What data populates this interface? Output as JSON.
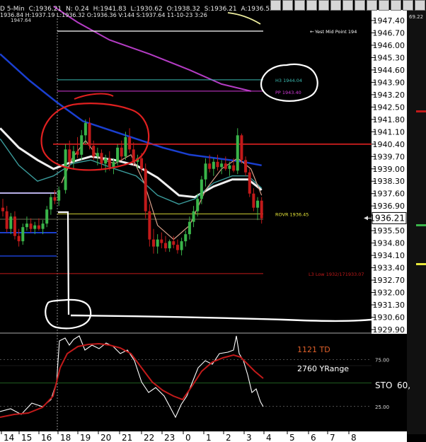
{
  "header": {
    "fields": [
      "D 5-Min",
      "C:1936.21",
      "N: 0.24",
      "H:1941.83",
      "L:1930.62",
      "O:1938.32",
      "S:1936.21",
      "A:1936.52"
    ],
    "fields2": [
      "1936.84",
      "H:1937.19",
      "L:1936.32",
      "O:1936.36",
      "V:144",
      "S:1937.64",
      "11-10-23",
      "3:26"
    ],
    "top_level_label": "1947.64",
    "right_edge_value": "69.22"
  },
  "chart_data": {
    "type": "line",
    "instrument_timeframe": "5-Min",
    "price_axis": {
      "ticks": [
        "1947.40",
        "1946.70",
        "1946.00",
        "1945.30",
        "1944.60",
        "1943.90",
        "1943.20",
        "1942.50",
        "1941.80",
        "1941.10",
        "1940.40",
        "1939.70",
        "1939.00",
        "1938.30",
        "1937.60",
        "1936.90",
        "1936.21",
        "1935.50",
        "1934.80",
        "1934.10",
        "1933.40",
        "1932.70",
        "1932.00",
        "1931.30",
        "1930.60",
        "1929.90"
      ],
      "current_price": "1936.21",
      "ylim": [
        1929.6,
        1948.0
      ]
    },
    "x_axis": {
      "ticks": [
        "14",
        "15",
        "16",
        "18",
        "19",
        "20",
        "21",
        "22",
        "23",
        "0",
        "1",
        "2",
        "3",
        "4",
        "5",
        "6",
        "7",
        "8"
      ]
    },
    "levels": [
      {
        "label": "Yest Mid Point 194",
        "price": 1946.8,
        "color": "#ffffff"
      },
      {
        "label": "H3 1944.04",
        "price": 1944.04,
        "color": "#3bb9b0"
      },
      {
        "label": "PP 1943.40",
        "price": 1943.4,
        "color": "#d23ad8"
      },
      {
        "label": "ROVR 1936.45",
        "price": 1936.45,
        "color": "#e8e83a"
      },
      {
        "label": "L3 Low 1932/171933.07",
        "price": 1933.07,
        "color": "#c21a1a"
      },
      {
        "label": "",
        "price": 1940.4,
        "color": "#e02020"
      }
    ],
    "candles": [
      {
        "x": 0.0,
        "o": 1936.8,
        "h": 1937.3,
        "l": 1936.3,
        "c": 1936.6
      },
      {
        "x": 0.15,
        "o": 1936.6,
        "h": 1936.9,
        "l": 1935.4,
        "c": 1935.6
      },
      {
        "x": 0.3,
        "o": 1935.6,
        "h": 1936.5,
        "l": 1935.3,
        "c": 1936.3
      },
      {
        "x": 0.45,
        "o": 1936.3,
        "h": 1936.6,
        "l": 1935.0,
        "c": 1935.2
      },
      {
        "x": 0.6,
        "o": 1935.2,
        "h": 1935.6,
        "l": 1934.6,
        "c": 1934.9
      },
      {
        "x": 0.75,
        "o": 1934.9,
        "h": 1935.9,
        "l": 1934.7,
        "c": 1935.7
      },
      {
        "x": 0.9,
        "o": 1935.7,
        "h": 1936.3,
        "l": 1935.5,
        "c": 1935.9
      },
      {
        "x": 1.05,
        "o": 1935.9,
        "h": 1936.2,
        "l": 1935.4,
        "c": 1935.6
      },
      {
        "x": 1.2,
        "o": 1935.6,
        "h": 1936.0,
        "l": 1935.3,
        "c": 1935.8
      },
      {
        "x": 1.35,
        "o": 1935.8,
        "h": 1936.2,
        "l": 1935.5,
        "c": 1935.6
      },
      {
        "x": 1.5,
        "o": 1935.6,
        "h": 1936.1,
        "l": 1935.3,
        "c": 1935.9
      },
      {
        "x": 1.65,
        "o": 1935.9,
        "h": 1936.9,
        "l": 1935.7,
        "c": 1936.7
      },
      {
        "x": 1.8,
        "o": 1936.7,
        "h": 1937.6,
        "l": 1936.4,
        "c": 1937.4
      },
      {
        "x": 1.95,
        "o": 1937.4,
        "h": 1937.8,
        "l": 1937.0,
        "c": 1937.2
      },
      {
        "x": 2.1,
        "o": 1937.2,
        "h": 1938.0,
        "l": 1936.9,
        "c": 1937.8
      },
      {
        "x": 2.35,
        "o": 1937.8,
        "h": 1940.4,
        "l": 1937.6,
        "c": 1940.1
      },
      {
        "x": 2.5,
        "o": 1940.1,
        "h": 1940.6,
        "l": 1939.1,
        "c": 1939.4
      },
      {
        "x": 2.65,
        "o": 1939.4,
        "h": 1940.3,
        "l": 1939.0,
        "c": 1940.0
      },
      {
        "x": 2.8,
        "o": 1940.0,
        "h": 1940.8,
        "l": 1939.6,
        "c": 1939.8
      },
      {
        "x": 2.95,
        "o": 1939.8,
        "h": 1941.2,
        "l": 1939.5,
        "c": 1940.9
      },
      {
        "x": 3.1,
        "o": 1940.9,
        "h": 1941.8,
        "l": 1940.4,
        "c": 1941.6
      },
      {
        "x": 3.25,
        "o": 1941.6,
        "h": 1941.9,
        "l": 1940.1,
        "c": 1940.3
      },
      {
        "x": 3.4,
        "o": 1940.3,
        "h": 1940.6,
        "l": 1939.5,
        "c": 1939.7
      },
      {
        "x": 3.55,
        "o": 1939.7,
        "h": 1940.2,
        "l": 1939.2,
        "c": 1939.9
      },
      {
        "x": 3.7,
        "o": 1939.9,
        "h": 1940.1,
        "l": 1939.0,
        "c": 1939.3
      },
      {
        "x": 3.85,
        "o": 1939.3,
        "h": 1939.8,
        "l": 1938.8,
        "c": 1939.6
      },
      {
        "x": 4.0,
        "o": 1939.6,
        "h": 1940.0,
        "l": 1938.9,
        "c": 1939.1
      },
      {
        "x": 4.15,
        "o": 1939.1,
        "h": 1939.6,
        "l": 1938.7,
        "c": 1939.4
      },
      {
        "x": 4.3,
        "o": 1939.4,
        "h": 1940.4,
        "l": 1939.2,
        "c": 1940.2
      },
      {
        "x": 4.45,
        "o": 1940.2,
        "h": 1940.6,
        "l": 1939.5,
        "c": 1939.7
      },
      {
        "x": 4.6,
        "o": 1939.7,
        "h": 1941.1,
        "l": 1939.5,
        "c": 1940.8
      },
      {
        "x": 4.75,
        "o": 1940.8,
        "h": 1941.3,
        "l": 1939.9,
        "c": 1940.1
      },
      {
        "x": 4.9,
        "o": 1940.1,
        "h": 1940.5,
        "l": 1939.2,
        "c": 1939.4
      },
      {
        "x": 5.05,
        "o": 1939.4,
        "h": 1939.8,
        "l": 1939.0,
        "c": 1939.6
      },
      {
        "x": 5.2,
        "o": 1939.6,
        "h": 1939.9,
        "l": 1938.8,
        "c": 1939.0
      },
      {
        "x": 5.35,
        "o": 1939.0,
        "h": 1939.3,
        "l": 1936.2,
        "c": 1936.6
      },
      {
        "x": 5.5,
        "o": 1936.6,
        "h": 1937.0,
        "l": 1934.6,
        "c": 1935.0
      },
      {
        "x": 5.65,
        "o": 1935.0,
        "h": 1935.6,
        "l": 1934.2,
        "c": 1934.6
      },
      {
        "x": 5.8,
        "o": 1934.6,
        "h": 1935.3,
        "l": 1934.2,
        "c": 1935.0
      },
      {
        "x": 5.95,
        "o": 1935.0,
        "h": 1935.4,
        "l": 1934.5,
        "c": 1934.8
      },
      {
        "x": 6.1,
        "o": 1934.8,
        "h": 1935.2,
        "l": 1934.3,
        "c": 1934.5
      },
      {
        "x": 6.25,
        "o": 1934.5,
        "h": 1935.0,
        "l": 1934.3,
        "c": 1934.9
      },
      {
        "x": 6.4,
        "o": 1934.9,
        "h": 1935.2,
        "l": 1934.5,
        "c": 1934.7
      },
      {
        "x": 6.55,
        "o": 1934.7,
        "h": 1935.0,
        "l": 1934.2,
        "c": 1934.4
      },
      {
        "x": 6.7,
        "o": 1934.4,
        "h": 1935.1,
        "l": 1934.1,
        "c": 1934.9
      },
      {
        "x": 6.85,
        "o": 1934.9,
        "h": 1935.5,
        "l": 1934.6,
        "c": 1935.3
      },
      {
        "x": 7.0,
        "o": 1935.3,
        "h": 1936.3,
        "l": 1935.0,
        "c": 1936.0
      },
      {
        "x": 7.15,
        "o": 1936.0,
        "h": 1936.9,
        "l": 1935.7,
        "c": 1936.6
      },
      {
        "x": 7.3,
        "o": 1936.6,
        "h": 1937.6,
        "l": 1936.3,
        "c": 1937.3
      },
      {
        "x": 7.45,
        "o": 1937.3,
        "h": 1938.6,
        "l": 1937.0,
        "c": 1938.4
      },
      {
        "x": 7.6,
        "o": 1938.4,
        "h": 1939.6,
        "l": 1938.0,
        "c": 1939.3
      },
      {
        "x": 7.75,
        "o": 1939.3,
        "h": 1939.8,
        "l": 1938.8,
        "c": 1939.0
      },
      {
        "x": 7.9,
        "o": 1939.0,
        "h": 1939.6,
        "l": 1938.6,
        "c": 1939.4
      },
      {
        "x": 8.05,
        "o": 1939.4,
        "h": 1939.8,
        "l": 1938.9,
        "c": 1939.1
      },
      {
        "x": 8.2,
        "o": 1939.1,
        "h": 1939.5,
        "l": 1938.7,
        "c": 1939.3
      },
      {
        "x": 8.35,
        "o": 1939.3,
        "h": 1939.7,
        "l": 1938.9,
        "c": 1939.0
      },
      {
        "x": 8.5,
        "o": 1939.0,
        "h": 1939.4,
        "l": 1938.6,
        "c": 1939.2
      },
      {
        "x": 8.65,
        "o": 1939.2,
        "h": 1939.6,
        "l": 1938.8,
        "c": 1938.9
      },
      {
        "x": 8.8,
        "o": 1938.9,
        "h": 1941.3,
        "l": 1938.7,
        "c": 1940.9
      },
      {
        "x": 8.95,
        "o": 1940.9,
        "h": 1941.0,
        "l": 1939.3,
        "c": 1939.5
      },
      {
        "x": 9.1,
        "o": 1939.5,
        "h": 1939.7,
        "l": 1938.6,
        "c": 1938.8
      },
      {
        "x": 9.25,
        "o": 1938.8,
        "h": 1939.0,
        "l": 1937.4,
        "c": 1937.6
      },
      {
        "x": 9.4,
        "o": 1937.6,
        "h": 1937.9,
        "l": 1936.6,
        "c": 1936.8
      },
      {
        "x": 9.55,
        "o": 1936.8,
        "h": 1937.4,
        "l": 1936.1,
        "c": 1937.2
      },
      {
        "x": 9.7,
        "o": 1937.2,
        "h": 1937.4,
        "l": 1935.9,
        "c": 1936.2
      }
    ],
    "stochastic": {
      "labels": [
        "STO",
        "60"
      ],
      "levels": [
        25,
        75
      ],
      "level_labels": [
        "25.00",
        "75.00"
      ],
      "ylim": [
        0,
        100
      ]
    },
    "annotations": [
      "1121 TD",
      "2760 YRange"
    ]
  }
}
